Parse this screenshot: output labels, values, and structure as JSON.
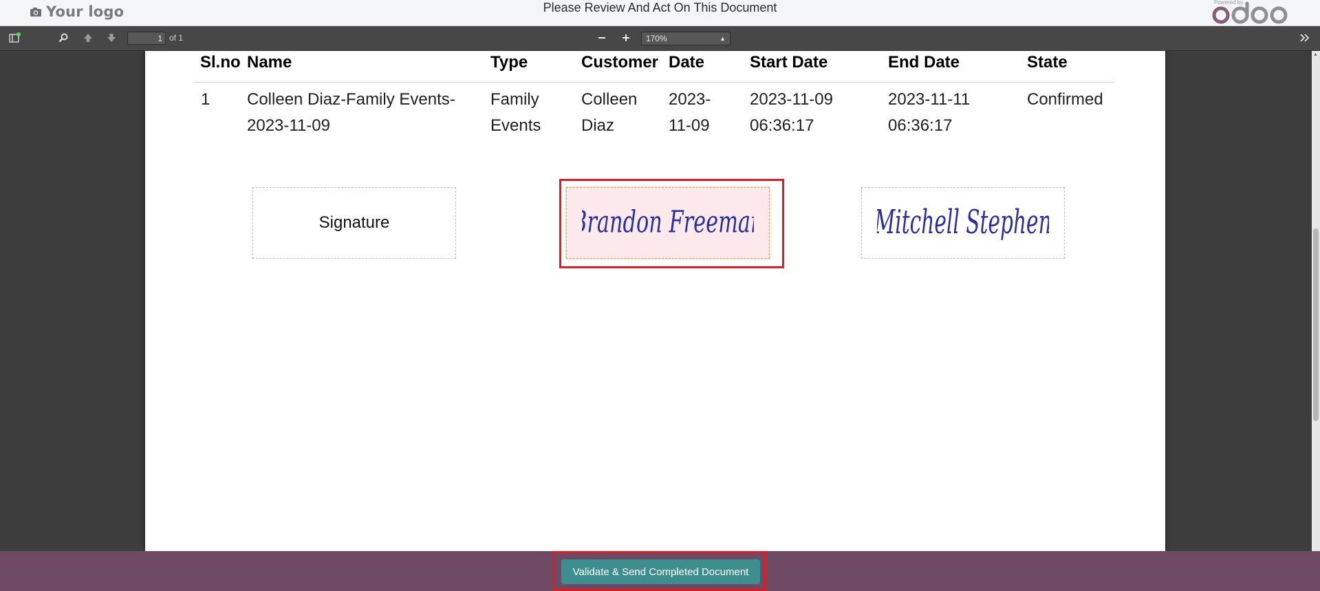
{
  "header": {
    "logo_text": "Your logo",
    "title": "Please Review And Act On This Document",
    "powered_by": "Powered by",
    "brand": "odoo",
    "brand_color": "#875A7B"
  },
  "toolbar": {
    "page_number": "1",
    "page_of": "of 1",
    "zoom": "170%"
  },
  "table": {
    "columns": [
      "Sl.no",
      "Name",
      "Type",
      "Customer",
      "Date",
      "Start Date",
      "End Date",
      "State"
    ],
    "rows": [
      {
        "slno": "1",
        "name_line1": "Colleen Diaz-Family Events-",
        "name_line2": "2023-11-09",
        "type_line1": "Family",
        "type_line2": "Events",
        "customer_line1": "Colleen",
        "customer_line2": "Diaz",
        "date_line1": "2023-",
        "date_line2": "11-09",
        "start_line1": "2023-11-09",
        "start_line2": "06:36:17",
        "end_line1": "2023-11-11",
        "end_line2": "06:36:17",
        "state": "Confirmed"
      }
    ]
  },
  "signatures": {
    "empty_label": "Signature",
    "signed_1": "Brandon Freeman",
    "signed_2": "Mitchell Stephen",
    "ink_color": "#2b2fa0"
  },
  "footer": {
    "validate_label": "Validate & Send Completed Document",
    "bar_color": "#6e4a64",
    "button_color": "#3f8e8f"
  },
  "annotation_color": "#e01b24"
}
